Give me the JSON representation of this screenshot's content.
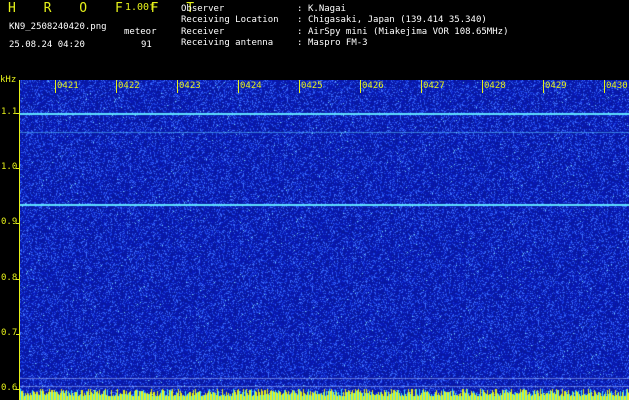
{
  "header": {
    "app_title": "H R O F F T",
    "version": "1.00f",
    "filename": "KN9_2508240420.png",
    "timestamp": "25.08.24 04:20",
    "meteor_label": "meteor",
    "meteor_count": "91"
  },
  "info": {
    "rows": [
      {
        "label": "Observer",
        "value": "K.Nagai"
      },
      {
        "label": "Receiving Location",
        "value": "Chigasaki, Japan (139.414 35.340)"
      },
      {
        "label": "Receiver",
        "value": "AirSpy mini (Miakejima VOR 108.65MHz)"
      },
      {
        "label": "Receiving antenna",
        "value": "Maspro FM-3"
      }
    ],
    "separator": ":"
  },
  "spectrogram": {
    "y_unit": "kHz",
    "y_ticks": [
      "1.1",
      "1.0",
      "0.9",
      "0.8",
      "0.7",
      "0.6"
    ],
    "x_ticks": [
      "0421",
      "0422",
      "0423",
      "0424",
      "0425",
      "0426",
      "0427",
      "0428",
      "0429",
      "0430"
    ],
    "y_range_khz": [
      0.58,
      1.16
    ],
    "signal_lines_khz": [
      1.1,
      1.065,
      0.935
    ],
    "colors": {
      "background": "#0a1fa8",
      "noise": "#4f7cff",
      "signal": "#5fe0ff",
      "baseline": "#e6f21a",
      "label": "#e6f21a"
    }
  }
}
